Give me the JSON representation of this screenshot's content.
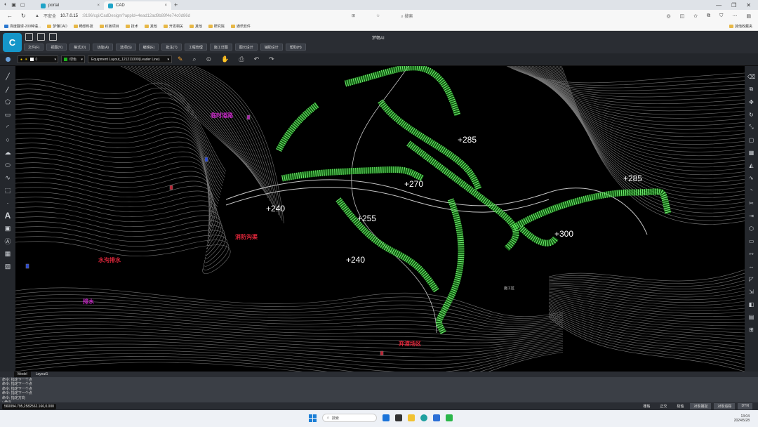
{
  "browser": {
    "tabs": [
      {
        "title": "portal",
        "active": false
      },
      {
        "title": "CAD",
        "active": true
      }
    ],
    "new_tab": "+",
    "address": {
      "security": "不安全",
      "host": "10.7.0.15",
      "path": ":8196/cgi/CadDesign/?appId=4ead12ad9b89f4e74c0d86d"
    },
    "search_placeholder": "搜索"
  },
  "bookmarks": [
    {
      "label": "百度翻译-200种语...",
      "kind": "blue"
    },
    {
      "label": "梦懂CAD",
      "kind": "folder"
    },
    {
      "label": "畅想科技",
      "kind": "folder"
    },
    {
      "label": "红板项目",
      "kind": "folder"
    },
    {
      "label": "技术",
      "kind": "folder"
    },
    {
      "label": "其他",
      "kind": "folder"
    },
    {
      "label": "开发相关",
      "kind": "folder"
    },
    {
      "label": "其他",
      "kind": "folder"
    },
    {
      "label": "研究院",
      "kind": "folder"
    },
    {
      "label": "通讯软件",
      "kind": "folder"
    }
  ],
  "bookmarks_right": "其他收藏夹",
  "app": {
    "logo_text": "C",
    "title": "梦畅AI",
    "menu": [
      "文件(F)",
      "视图(V)",
      "格式(O)",
      "功能(A)",
      "选项(S)",
      "编辑(E)",
      "批注(T)",
      "工程管理",
      "施工详图",
      "图元设计",
      "辅助设计",
      "帮助(H)"
    ]
  },
  "layer_toolbar": {
    "layer_value": "0",
    "color_label": "绿色",
    "style_value": "Equipment Layout_121211000(Leader Line)"
  },
  "canvas": {
    "elevations": [
      "+285",
      "+270",
      "+255",
      "+240",
      "+240",
      "+300",
      "+285"
    ],
    "red_labels": [
      "消防沟渠",
      "水沟排水",
      "弃渣场区"
    ],
    "magenta_labels": [
      "临时道路",
      "排水"
    ],
    "small_label": "施工区"
  },
  "layout_tabs": [
    "Model",
    "Layout1"
  ],
  "command_lines": [
    "命令: 指定下一个点",
    "命令: 指定下一个点",
    "命令: 指定下一个点",
    "命令: 指定下一个点",
    "命令: 指定方向"
  ],
  "command_prompt": "命令",
  "coordinates": "560094.795,2582562.166,0.000",
  "status_buttons": [
    {
      "label": "栅格",
      "on": false
    },
    {
      "label": "正交",
      "on": false
    },
    {
      "label": "极轴",
      "on": false
    },
    {
      "label": "对象捕捉",
      "on": true
    },
    {
      "label": "对象追踪",
      "on": true
    },
    {
      "label": "DYN",
      "on": true
    }
  ],
  "taskbar": {
    "search": "搜索",
    "time": "13:04",
    "date": "2024/5/28"
  },
  "colors": {
    "accent": "#1596c9",
    "green_line": "#2ee02e",
    "red_text": "#e0263a"
  }
}
